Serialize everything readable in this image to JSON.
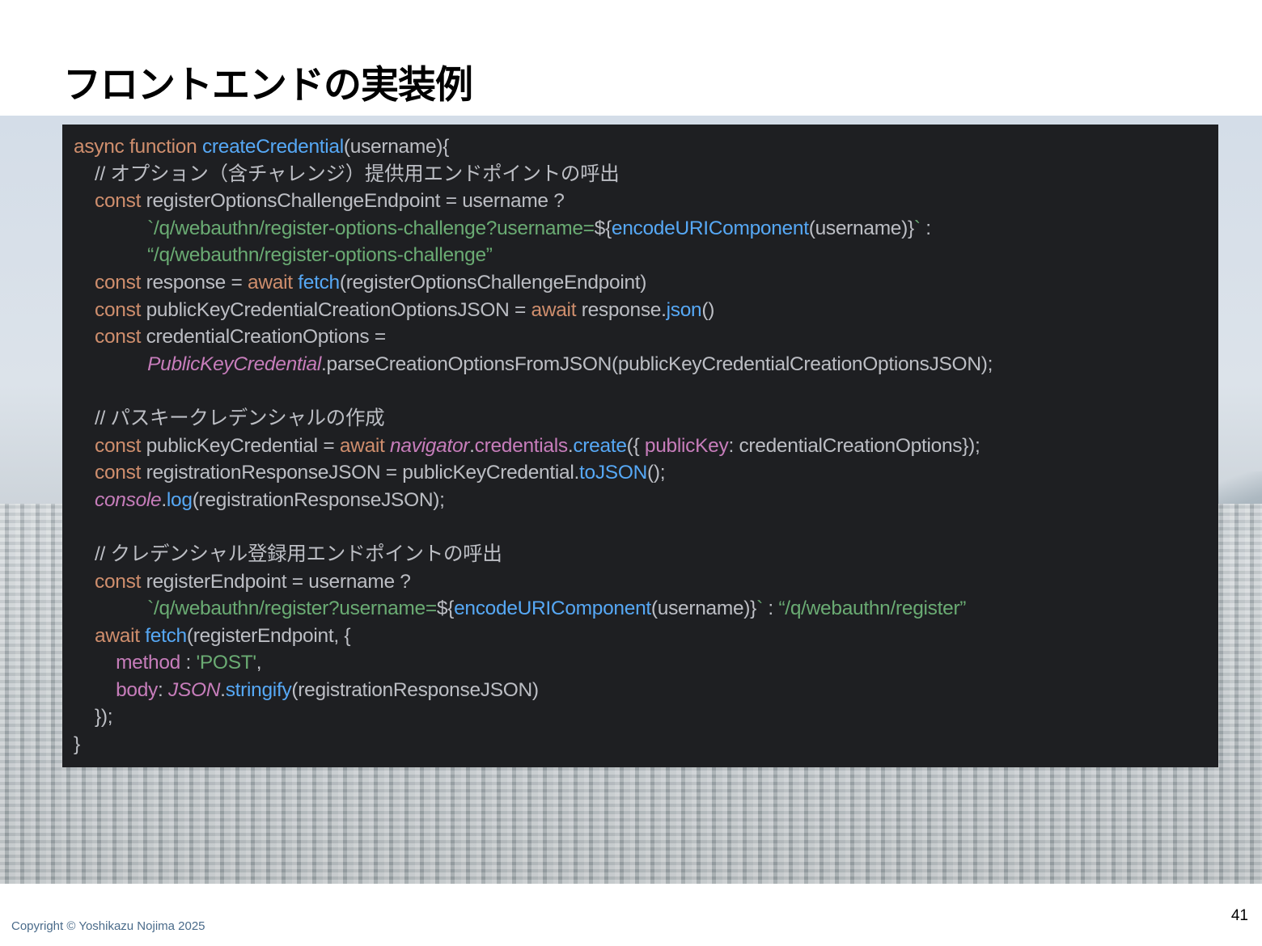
{
  "title": "フロントエンドの実装例",
  "code_lines": [
    [
      [
        "kw",
        "async function "
      ],
      [
        "fn",
        "createCredential"
      ],
      [
        "p",
        "(username){"
      ]
    ],
    [
      [
        "p",
        "    "
      ],
      [
        "cmt",
        "// オプション（含チャレンジ）提供用エンドポイントの呼出"
      ]
    ],
    [
      [
        "p",
        "    "
      ],
      [
        "kw",
        "const "
      ],
      [
        "p",
        "registerOptionsChallengeEndpoint = username ?"
      ]
    ],
    [
      [
        "p",
        "              "
      ],
      [
        "str",
        "`/q/webauthn/register-options-challenge?username="
      ],
      [
        "p",
        "${"
      ],
      [
        "fn",
        "encodeURIComponent"
      ],
      [
        "p",
        "(username)}"
      ],
      [
        "str",
        "`"
      ],
      [
        "p",
        " :"
      ]
    ],
    [
      [
        "p",
        "              "
      ],
      [
        "str",
        "“/q/webauthn/register-options-challenge”"
      ]
    ],
    [
      [
        "p",
        "    "
      ],
      [
        "kw",
        "const "
      ],
      [
        "p",
        "response = "
      ],
      [
        "kw",
        "await "
      ],
      [
        "fn",
        "fetch"
      ],
      [
        "p",
        "(registerOptionsChallengeEndpoint)"
      ]
    ],
    [
      [
        "p",
        "    "
      ],
      [
        "kw",
        "const "
      ],
      [
        "p",
        "publicKeyCredentialCreationOptionsJSON = "
      ],
      [
        "kw",
        "await "
      ],
      [
        "p",
        "response."
      ],
      [
        "fn",
        "json"
      ],
      [
        "p",
        "()"
      ]
    ],
    [
      [
        "p",
        "    "
      ],
      [
        "kw",
        "const "
      ],
      [
        "p",
        "credentialCreationOptions ="
      ]
    ],
    [
      [
        "p",
        "              "
      ],
      [
        "glob",
        "PublicKeyCredential"
      ],
      [
        "p",
        ".parseCreationOptionsFromJSON(publicKeyCredentialCreationOptionsJSON);"
      ]
    ],
    [
      [
        "p",
        ""
      ]
    ],
    [
      [
        "p",
        "    "
      ],
      [
        "cmt",
        "// パスキークレデンシャルの作成"
      ]
    ],
    [
      [
        "p",
        "    "
      ],
      [
        "kw",
        "const "
      ],
      [
        "p",
        "publicKeyCredential = "
      ],
      [
        "kw",
        "await "
      ],
      [
        "glob",
        "navigator"
      ],
      [
        "p",
        "."
      ],
      [
        "prop",
        "credentials"
      ],
      [
        "p",
        "."
      ],
      [
        "fn",
        "create"
      ],
      [
        "p",
        "({ "
      ],
      [
        "prop",
        "publicKey"
      ],
      [
        "p",
        ": credentialCreationOptions});"
      ]
    ],
    [
      [
        "p",
        "    "
      ],
      [
        "kw",
        "const "
      ],
      [
        "p",
        "registrationResponseJSON = publicKeyCredential."
      ],
      [
        "fn",
        "toJSON"
      ],
      [
        "p",
        "();"
      ]
    ],
    [
      [
        "p",
        "    "
      ],
      [
        "glob",
        "console"
      ],
      [
        "p",
        "."
      ],
      [
        "fn",
        "log"
      ],
      [
        "p",
        "(registrationResponseJSON);"
      ]
    ],
    [
      [
        "p",
        ""
      ]
    ],
    [
      [
        "p",
        "    "
      ],
      [
        "cmt",
        "// クレデンシャル登録用エンドポイントの呼出"
      ]
    ],
    [
      [
        "p",
        "    "
      ],
      [
        "kw",
        "const "
      ],
      [
        "p",
        "registerEndpoint = username ?"
      ]
    ],
    [
      [
        "p",
        "              "
      ],
      [
        "str",
        "`/q/webauthn/register?username="
      ],
      [
        "p",
        "${"
      ],
      [
        "fn",
        "encodeURIComponent"
      ],
      [
        "p",
        "(username)}"
      ],
      [
        "str",
        "`"
      ],
      [
        "p",
        " : "
      ],
      [
        "str",
        "“/q/webauthn/register”"
      ]
    ],
    [
      [
        "p",
        "    "
      ],
      [
        "kw",
        "await "
      ],
      [
        "fn",
        "fetch"
      ],
      [
        "p",
        "(registerEndpoint, {"
      ]
    ],
    [
      [
        "p",
        "        "
      ],
      [
        "prop",
        "method "
      ],
      [
        "p",
        ": "
      ],
      [
        "str",
        "'POST'"
      ],
      [
        "p",
        ","
      ]
    ],
    [
      [
        "p",
        "        "
      ],
      [
        "prop",
        "body"
      ],
      [
        "p",
        ": "
      ],
      [
        "glob",
        "JSON"
      ],
      [
        "p",
        "."
      ],
      [
        "fn",
        "stringify"
      ],
      [
        "p",
        "(registrationResponseJSON)"
      ]
    ],
    [
      [
        "p",
        "    });"
      ]
    ],
    [
      [
        "p",
        "}"
      ]
    ]
  ],
  "footer": {
    "copyright": "Copyright © Yoshikazu Nojima 2025",
    "page_number": "41"
  },
  "colors": {
    "code_background": "#1e1f22",
    "keyword": "#cf8e6d",
    "function": "#56a8f5",
    "string": "#6aab73",
    "property": "#c77dbb",
    "plain": "#bcbec4"
  }
}
